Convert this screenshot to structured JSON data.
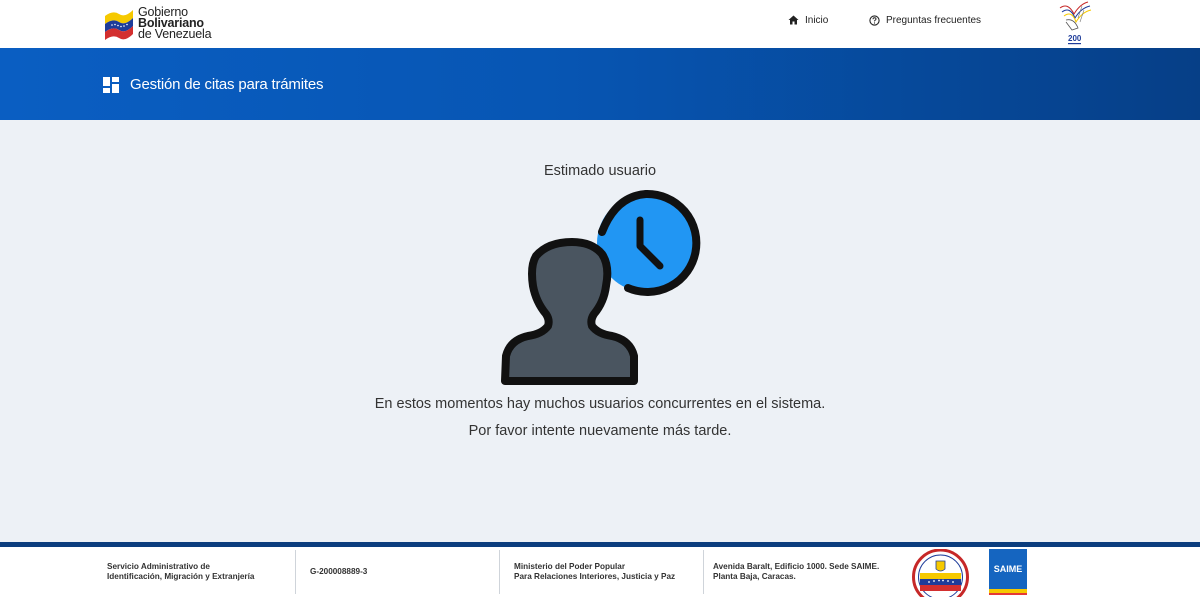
{
  "header": {
    "gov_logo": {
      "line1": "Gobierno",
      "line2": "Bolivariano",
      "line3": "de Venezuela",
      "flag_icon": "venezuela-flag-icon"
    },
    "nav": [
      {
        "label": "Inicio",
        "icon": "home-icon"
      },
      {
        "label": "Preguntas frecuentes",
        "icon": "question-circle-icon"
      }
    ],
    "emblem": {
      "icon": "bicentennial-emblem",
      "text": "200"
    }
  },
  "band": {
    "icon": "dashboard-grid-icon",
    "title": "Gestión de citas para trámites"
  },
  "main": {
    "heading": "Estimado usuario",
    "illustration": "user-clock-icon",
    "message_line1": "En estos momentos hay muchos usuarios concurrentes en el sistema.",
    "message_line2": "Por favor intente nuevamente más tarde."
  },
  "footer": {
    "org_line1": "Servicio Administrativo de",
    "org_line2": "Identificación, Migración y Extranjería",
    "rif": "G-200008889-3",
    "ministry_line1": "Ministerio del Poder Popular",
    "ministry_line2": "Para Relaciones Interiores, Justicia y Paz",
    "address_line1": "Avenida Baralt, Edificio 1000. Sede SAIME.",
    "address_line2": "Planta Baja, Caracas.",
    "saime_logo_text": "SAIME",
    "seal_icon": "ministry-seal-icon"
  },
  "colors": {
    "band_start": "#0a5ec2",
    "band_end": "#063f87",
    "page_bg": "#edf1f6",
    "clock_blue": "#2196f3",
    "user_gray": "#4a5560",
    "footer_line": "#0b3d7e"
  }
}
